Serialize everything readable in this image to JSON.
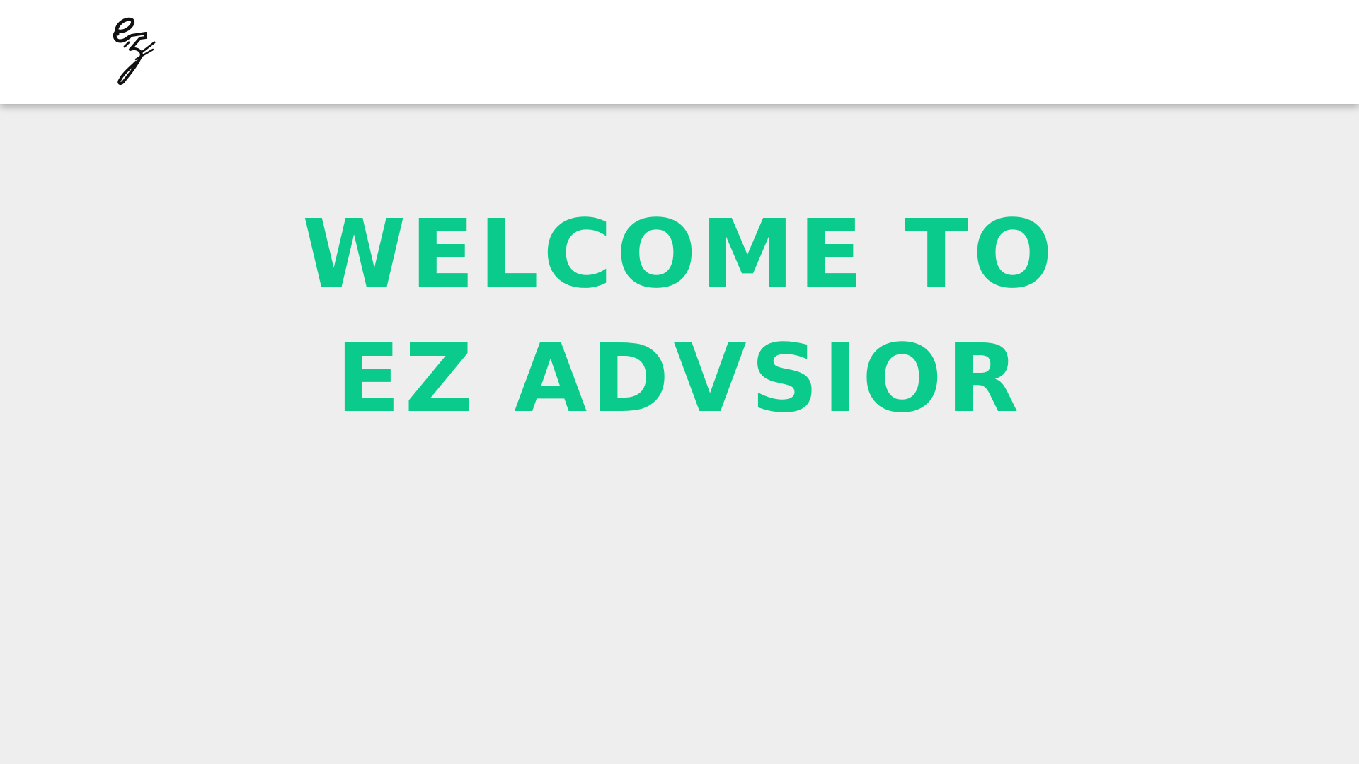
{
  "theme": {
    "accent": "#0acb8b",
    "header_bg": "#ffffff",
    "page_bg": "#eeeeee"
  },
  "header": {
    "logo": {
      "icon": "ez-script-logo-icon",
      "text": "ez"
    }
  },
  "hero": {
    "line_1": "WELCOME TO",
    "line_2": "EZ ADVSIOR"
  }
}
